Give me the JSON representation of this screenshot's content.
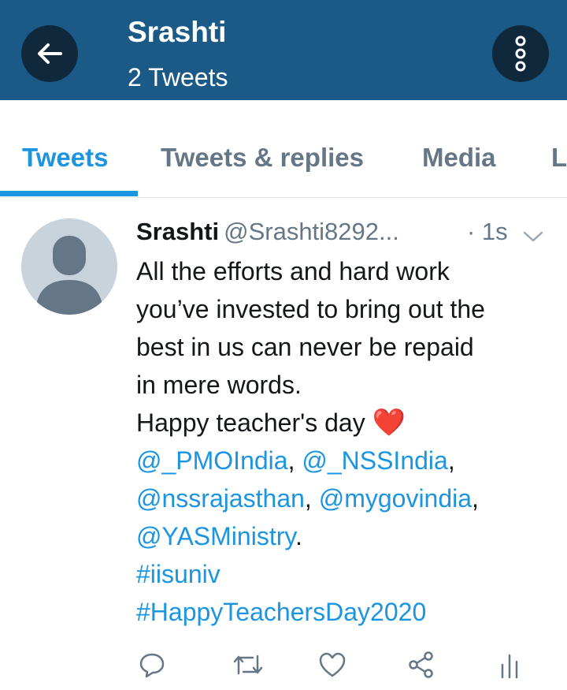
{
  "header": {
    "title": "Srashti",
    "subtitle": "2 Tweets",
    "back_icon": "arrow-left-icon",
    "more_icon": "more-vertical-icon"
  },
  "tabs": [
    {
      "label": "Tweets",
      "active": true
    },
    {
      "label": "Tweets & replies",
      "active": false
    },
    {
      "label": "Media",
      "active": false
    },
    {
      "label": "L",
      "active": false
    }
  ],
  "tweet": {
    "name": "Srashti",
    "handle": "@Srashti8292...",
    "time": "· 1s",
    "text": {
      "l1": "All the efforts and hard work",
      "l2": "you’ve invested to bring out the",
      "l3": "best in us can never be repaid",
      "l4": "in mere words.",
      "l5": "Happy teacher's day",
      "heart": "❤️",
      "m1": "@_PMOIndia",
      "m2": "@_NSSIndia",
      "m3": "@nssrajasthan",
      "m4": "@mygovindia",
      "m5": "@YASMinistry",
      "comma": ",",
      "period": ".",
      "h1": "#iisuniv",
      "h2": "#HappyTeachersDay2020"
    }
  },
  "actions": [
    "reply-icon",
    "retweet-icon",
    "like-icon",
    "share-icon",
    "analytics-icon"
  ],
  "colors": {
    "header_bg": "#1b5a87",
    "accent": "#1b95e0",
    "muted": "#657786"
  }
}
